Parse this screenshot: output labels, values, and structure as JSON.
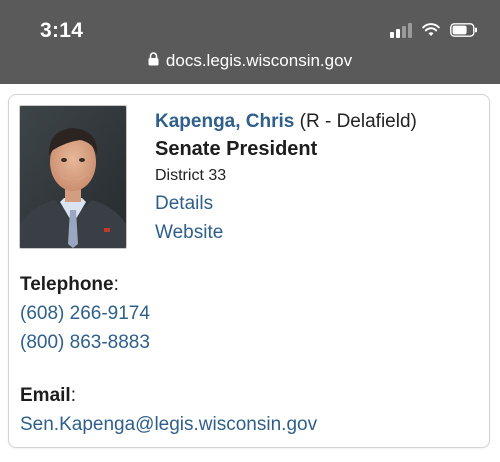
{
  "status_bar": {
    "time": "3:14",
    "url": "docs.legis.wisconsin.gov",
    "icons": [
      "signal-icon",
      "wifi-icon",
      "battery-icon",
      "lock-icon"
    ]
  },
  "profile": {
    "name": "Kapenga, Chris",
    "party_district": "(R - Delafield)",
    "title": "Senate President",
    "district": "District 33",
    "links": [
      "Details",
      "Website"
    ]
  },
  "telephone": {
    "label": "Telephone",
    "suffix": ":",
    "numbers": [
      "(608) 266-9174",
      "(800) 863-8883"
    ]
  },
  "email": {
    "label": "Email",
    "suffix": ":",
    "address": "Sen.Kapenga@legis.wisconsin.gov"
  },
  "colors": {
    "link": "#2f5f8a",
    "status_bar_bg": "#5a5a5a"
  }
}
